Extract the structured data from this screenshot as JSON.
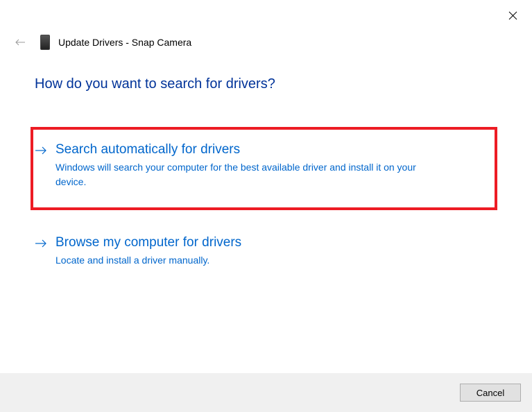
{
  "header": {
    "title": "Update Drivers - Snap Camera"
  },
  "question": "How do you want to search for drivers?",
  "options": [
    {
      "title": "Search automatically for drivers",
      "description": "Windows will search your computer for the best available driver and install it on your device."
    },
    {
      "title": "Browse my computer for drivers",
      "description": "Locate and install a driver manually."
    }
  ],
  "footer": {
    "cancel_label": "Cancel"
  }
}
